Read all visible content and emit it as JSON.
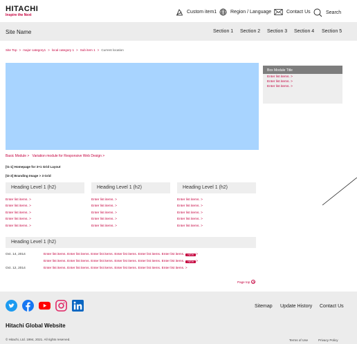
{
  "header": {
    "logo_main": "HITACHI",
    "logo_tagline": "Inspire the Next",
    "custom_item": "Custom item1",
    "region_language": "Region / Language",
    "contact_us": "Contact Us",
    "search": "Search"
  },
  "sitebar": {
    "site_name": "Site Name",
    "sections": [
      "Section 1",
      "Section 2",
      "Section 3",
      "Section 4",
      "Section 5"
    ]
  },
  "breadcrumb": {
    "items": [
      "Site Top",
      "major category1",
      "local category 1",
      "Sub item 1"
    ],
    "current": "Current location"
  },
  "hero": {
    "color": "#a8d4ff"
  },
  "box_module": {
    "title": "Box Module Title",
    "items": [
      "Enter list items. >",
      "Enter list items. >",
      "Enter list items. >"
    ]
  },
  "basic_module": {
    "link1": "Basic Module >",
    "link2": "Variation module for Responsive Web Design >"
  },
  "labels": {
    "layout": "[t1-1] Homepage for 3+1 Grid Layout",
    "branding": "[t2-3] Branding Image > 3 Grid"
  },
  "columns": [
    {
      "heading": "Heading Level 1 (h2)",
      "items": [
        "Enter list items. >",
        "Enter list items. >",
        "Enter list items. >",
        "Enter list items. >",
        "Enter list items. >"
      ]
    },
    {
      "heading": "Heading Level 1 (h2)",
      "items": [
        "Enter list items. >",
        "Enter list items. >",
        "Enter list items. >",
        "Enter list items. >",
        "Enter list items. >"
      ]
    },
    {
      "heading": "Heading Level 1 (h2)",
      "items": [
        "Enter list items. >",
        "Enter list items. >",
        "Enter list items. >",
        "Enter list items. >",
        "Enter list items. >"
      ]
    }
  ],
  "news": {
    "heading": "Heading Level 1 (h2)",
    "rows": [
      {
        "date": "Oct. 14, 2014",
        "text": "Enter list items. Enter list items. Enter list items. Enter list items. Enter list items. Enter list items.",
        "badge": "NEW",
        "tail": ">"
      },
      {
        "date": "",
        "text": "Enter list items. Enter list items. Enter list items. Enter list items. Enter list items. Enter list items.",
        "badge": "NEW",
        "tail": ">"
      },
      {
        "date": "Oct. 12, 2014",
        "text": "Enter list items. Enter list items. Enter list items. Enter list items. Enter list items. Enter list items. >",
        "badge": "",
        "tail": ""
      }
    ]
  },
  "page_top": "Page top",
  "footer": {
    "social_icons": [
      "twitter-icon",
      "facebook-icon",
      "youtube-icon",
      "instagram-icon",
      "linkedin-icon"
    ],
    "links": [
      "Sitemap",
      "Update History",
      "Contact Us"
    ],
    "global_title": "Hitachi Global Website",
    "copyright": "© Hitachi, Ltd. 1994, 2021. All rights reserved.",
    "legal": [
      "Terms of Use",
      "Privacy Policy"
    ]
  },
  "colors": {
    "accent": "#c5003e",
    "band": "#ececec",
    "hero": "#a8d4ff"
  }
}
